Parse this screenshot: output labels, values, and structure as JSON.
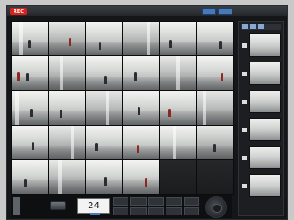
{
  "window": {
    "rec_badge": "REC",
    "accent_blue": "#4a78b6",
    "rec_red": "#d6241d"
  },
  "controls": {
    "counter_value": "24"
  },
  "icons": {
    "left_control": "panel-toggle-icon",
    "jog": "jog-dial-icon"
  }
}
